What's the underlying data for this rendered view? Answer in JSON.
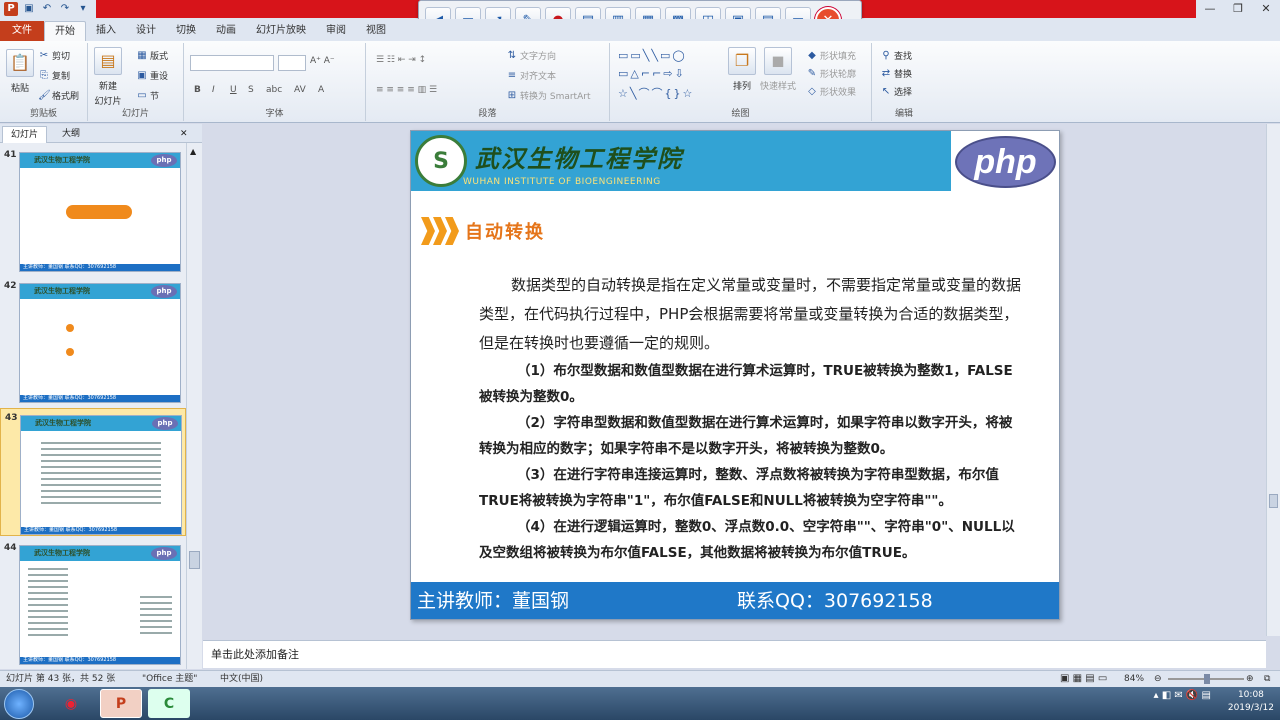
{
  "ribbon_tabs": [
    "文件",
    "开始",
    "插入",
    "设计",
    "切换",
    "动画",
    "幻灯片放映",
    "审阅",
    "视图"
  ],
  "clipboard": {
    "paste": "粘贴",
    "cut": "剪切",
    "copy": "复制",
    "format_painter": "格式刷",
    "label": "剪贴板"
  },
  "slides_group": {
    "new_slide": "新建",
    "new_slide2": "幻灯片",
    "layout": "版式",
    "reset": "重设",
    "section": "节",
    "label": "幻灯片"
  },
  "font_group": {
    "label": "字体"
  },
  "paragraph_group": {
    "text_direction": "文字方向",
    "align_text": "对齐文本",
    "convert_smartart": "转换为 SmartArt",
    "label": "段落"
  },
  "drawing_group": {
    "arrange": "排列",
    "quick_styles": "快速样式",
    "shape_fill": "形状填充",
    "shape_outline": "形状轮廓",
    "shape_effects": "形状效果",
    "label": "绘图"
  },
  "editing_group": {
    "find": "查找",
    "replace": "替换",
    "select": "选择",
    "label": "编辑"
  },
  "pane_tabs": {
    "slides": "幻灯片",
    "outline": "大纲"
  },
  "thumbnails": [
    {
      "num": "41",
      "school": "武汉生物工程学院",
      "footer": "主讲教师：董国钢        联系QQ：307692158"
    },
    {
      "num": "42",
      "school": "武汉生物工程学院",
      "footer": "主讲教师：董国钢        联系QQ：307692158"
    },
    {
      "num": "43",
      "school": "武汉生物工程学院",
      "footer": "主讲教师：董国钢        联系QQ：307692158"
    },
    {
      "num": "44",
      "school": "武汉生物工程学院",
      "footer": "主讲教师：董国钢        联系QQ：307692158"
    }
  ],
  "thumb_php": "php",
  "slide": {
    "school_cn": "武汉生物工程学院",
    "school_en": "WUHAN INSTITUTE OF BIOENGINEERING",
    "php_logo": "php",
    "title": "自动转换",
    "intro": "数据类型的自动转换是指在定义常量或变量时，不需要指定常量或变量的数据类型，在代码执行过程中，PHP会根据需要将常量或变量转换为合适的数据类型，但是在转换时也要遵循一定的规则。",
    "rules": [
      "（1）布尔型数据和数值型数据在进行算术运算时，TRUE被转换为整数1，FALSE被转换为整数0。",
      "（2）字符串型数据和数值型数据在进行算术运算时，如果字符串以数字开头，将被转换为相应的数字；如果字符串不是以数字开头，将被转换为整数0。",
      "（3）在进行字符串连接运算时，整数、浮点数将被转换为字符串型数据，布尔值TRUE将被转换为字符串\"1\"，布尔值FALSE和NULL将被转换为空字符串\"\"。",
      "（4）在进行逻辑运算时，整数0、浮点数0.0、空字符串\"\"、字符串\"0\"、NULL以及空数组将被转换为布尔值FALSE，其他数据将被转换为布尔值TRUE。"
    ],
    "footer_teacher": "主讲教师：董国钢",
    "footer_qq": "联系QQ：307692158"
  },
  "notes_placeholder": "单击此处添加备注",
  "status": {
    "slide_info": "幻灯片 第 43 张，共 52 张",
    "theme": "\"Office 主题\"",
    "language": "中文(中国)",
    "zoom": "84%"
  },
  "tray": {
    "time": "10:08",
    "date": "2019/3/12"
  },
  "colors": {
    "file_tab": "#c43e1c",
    "header_blue": "#33a3d4",
    "footer_blue": "#1f78c8",
    "title_orange": "#e5751a",
    "recording_bar": "#d7141a"
  }
}
